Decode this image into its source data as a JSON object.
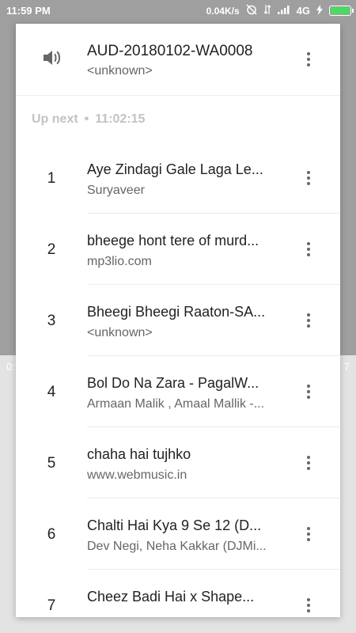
{
  "status_bar": {
    "time": "11:59 PM",
    "net_speed": "0.04K/s",
    "network": "4G"
  },
  "background": {
    "left_time": "0:",
    "right_time": "7"
  },
  "now_playing": {
    "title": "AUD-20180102-WA0008",
    "artist": "<unknown>",
    "icon": "speaker-icon"
  },
  "up_next": {
    "label": "Up next",
    "separator": "•",
    "duration": "11:02:15"
  },
  "queue": [
    {
      "num": "1",
      "title": "Aye Zindagi Gale Laga Le...",
      "artist": "Suryaveer"
    },
    {
      "num": "2",
      "title": "bheege hont tere of murd...",
      "artist": "mp3lio.com"
    },
    {
      "num": "3",
      "title": "Bheegi Bheegi Raaton-SA...",
      "artist": "<unknown>"
    },
    {
      "num": "4",
      "title": "Bol Do Na Zara - PagalW...",
      "artist": "Armaan Malik , Amaal Mallik -..."
    },
    {
      "num": "5",
      "title": "chaha hai tujhko",
      "artist": "www.webmusic.in"
    },
    {
      "num": "6",
      "title": "Chalti Hai Kya 9 Se 12 (D...",
      "artist": "Dev Negi, Neha Kakkar (DJMi..."
    },
    {
      "num": "7",
      "title": "Cheez Badi Hai x Shape...",
      "artist": ""
    }
  ],
  "colors": {
    "battery": "#4cd964",
    "accent_text": "#222222"
  }
}
